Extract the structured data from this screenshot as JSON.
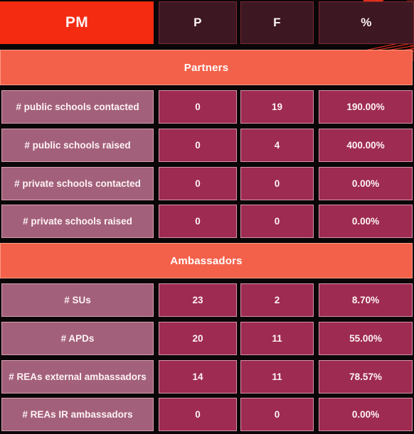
{
  "colors": {
    "background": "#0a0608",
    "pm_header": "#F42A11",
    "header_cell": "#3D1823",
    "section_band": "#F4614A",
    "label_cell": "#A3607A",
    "value_cell": "#9E2B51",
    "text": "#fdf4f4"
  },
  "header": {
    "columns": [
      {
        "label": "PM"
      },
      {
        "label": "P"
      },
      {
        "label": "F"
      },
      {
        "label": "%"
      }
    ]
  },
  "sections": [
    {
      "title": "Partners",
      "rows": [
        {
          "label": "# public schools contacted",
          "p": "0",
          "f": "19",
          "pct": "190.00%"
        },
        {
          "label": "# public schools raised",
          "p": "0",
          "f": "4",
          "pct": "400.00%"
        },
        {
          "label": "# private schools contacted",
          "p": "0",
          "f": "0",
          "pct": "0.00%"
        },
        {
          "label": "# private schools raised",
          "p": "0",
          "f": "0",
          "pct": "0.00%"
        }
      ]
    },
    {
      "title": "Ambassadors",
      "rows": [
        {
          "label": "# SUs",
          "p": "23",
          "f": "2",
          "pct": "8.70%"
        },
        {
          "label": "# APDs",
          "p": "20",
          "f": "11",
          "pct": "55.00%"
        },
        {
          "label": "# REAs external ambassadors",
          "p": "14",
          "f": "11",
          "pct": "78.57%"
        },
        {
          "label": "# REAs IR ambassadors",
          "p": "0",
          "f": "0",
          "pct": "0.00%"
        }
      ]
    }
  ],
  "decoration": {
    "name": "diagonal-streaks",
    "color": "#E8311A"
  }
}
